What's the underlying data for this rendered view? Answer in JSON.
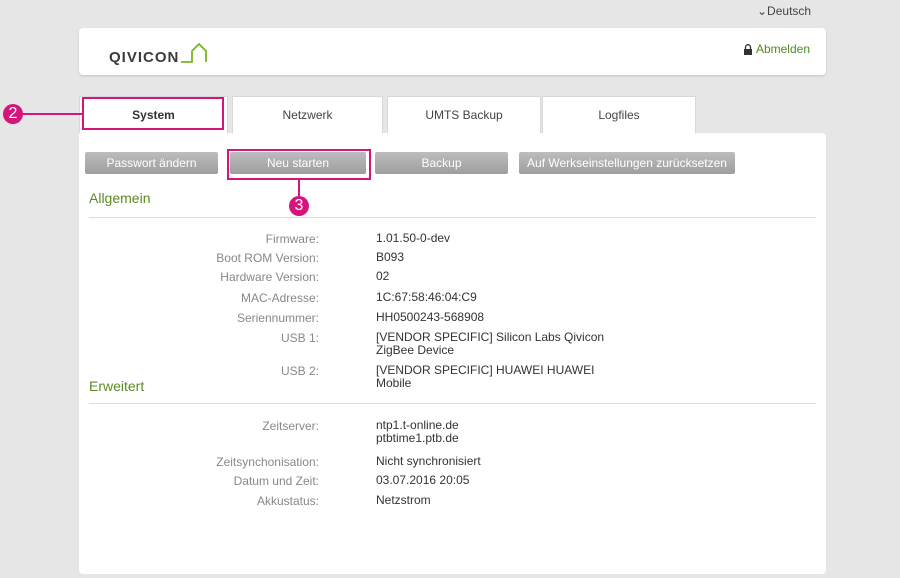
{
  "header": {
    "language": "⌄Deutsch",
    "logo_text": "QIVICON",
    "logout": "Abmelden"
  },
  "tabs": [
    {
      "label": "System",
      "active": true
    },
    {
      "label": "Netzwerk",
      "active": false
    },
    {
      "label": "UMTS Backup",
      "active": false
    },
    {
      "label": "Logfiles",
      "active": false
    }
  ],
  "actions": {
    "password": "Passwort ändern",
    "restart": "Neu starten",
    "backup": "Backup",
    "factory_reset": "Auf Werkseinstellungen zurücksetzen"
  },
  "general": {
    "title": "Allgemein",
    "rows": [
      {
        "label": "Firmware:",
        "value": "1.01.50-0-dev"
      },
      {
        "label": "Boot ROM Version:",
        "value": "B093"
      },
      {
        "label": "Hardware Version:",
        "value": "02"
      },
      {
        "label": "MAC-Adresse:",
        "value": "1C:67:58:46:04:C9"
      },
      {
        "label": "Seriennummer:",
        "value": "HH0500243-568908"
      },
      {
        "label": "USB 1:",
        "value": "[VENDOR SPECIFIC] Silicon Labs Qivicon",
        "value2": "ZigBee Device"
      },
      {
        "label": "USB 2:",
        "value": "[VENDOR SPECIFIC] HUAWEI HUAWEI",
        "value2": "Mobile"
      }
    ]
  },
  "advanced": {
    "title": "Erweitert",
    "rows": [
      {
        "label": "Zeitserver:",
        "value": "ntp1.t-online.de",
        "value2": "ptbtime1.ptb.de"
      },
      {
        "label": "Zeitsynchonisation:",
        "value": "Nicht synchronisiert"
      },
      {
        "label": "Datum und Zeit:",
        "value": "03.07.2016  20:05"
      },
      {
        "label": "Akkustatus:",
        "value": "Netzstrom"
      }
    ]
  },
  "annotations": {
    "marker_tab": "2",
    "marker_restart": "3"
  },
  "colors": {
    "accent_green": "#5b8c22",
    "highlight_magenta": "#d6157a",
    "button_gray": "#a8a8a8"
  }
}
